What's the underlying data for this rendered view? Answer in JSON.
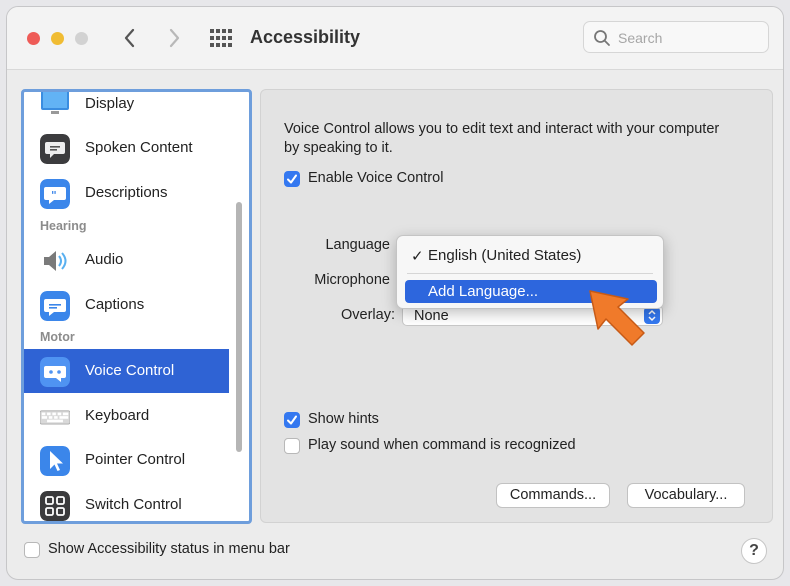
{
  "window": {
    "title": "Accessibility",
    "search_placeholder": "Search"
  },
  "sidebar": {
    "items": [
      {
        "label": "Display",
        "icon": "display-icon"
      },
      {
        "label": "Spoken Content",
        "icon": "speech-bubble-icon"
      },
      {
        "label": "Descriptions",
        "icon": "quote-bubble-icon"
      },
      {
        "label": "Audio",
        "icon": "speaker-icon"
      },
      {
        "label": "Captions",
        "icon": "captions-icon"
      },
      {
        "label": "Voice Control",
        "icon": "voice-control-icon",
        "selected": true
      },
      {
        "label": "Keyboard",
        "icon": "keyboard-icon"
      },
      {
        "label": "Pointer Control",
        "icon": "pointer-icon"
      },
      {
        "label": "Switch Control",
        "icon": "switch-grid-icon"
      }
    ],
    "sections": {
      "hearing": "Hearing",
      "motor": "Motor"
    }
  },
  "content": {
    "description": "Voice Control allows you to edit text and interact with your computer by speaking to it.",
    "enable_label": "Enable Voice Control",
    "enable_checked": true,
    "language_label": "Language",
    "microphone_label": "Microphone",
    "overlay_label": "Overlay:",
    "overlay_value": "None",
    "show_hints_label": "Show hints",
    "show_hints_checked": true,
    "play_sound_label": "Play sound when command is recognized",
    "play_sound_checked": false,
    "commands_button": "Commands...",
    "vocabulary_button": "Vocabulary..."
  },
  "language_menu": {
    "checkmark": "✓",
    "current": "English (United States)",
    "add": "Add Language..."
  },
  "footer": {
    "status_label": "Show Accessibility status in menu bar",
    "status_checked": false,
    "help": "?"
  },
  "colors": {
    "accent": "#3478f0",
    "selection": "#2f63d4",
    "arrow": "#f07a2a"
  }
}
